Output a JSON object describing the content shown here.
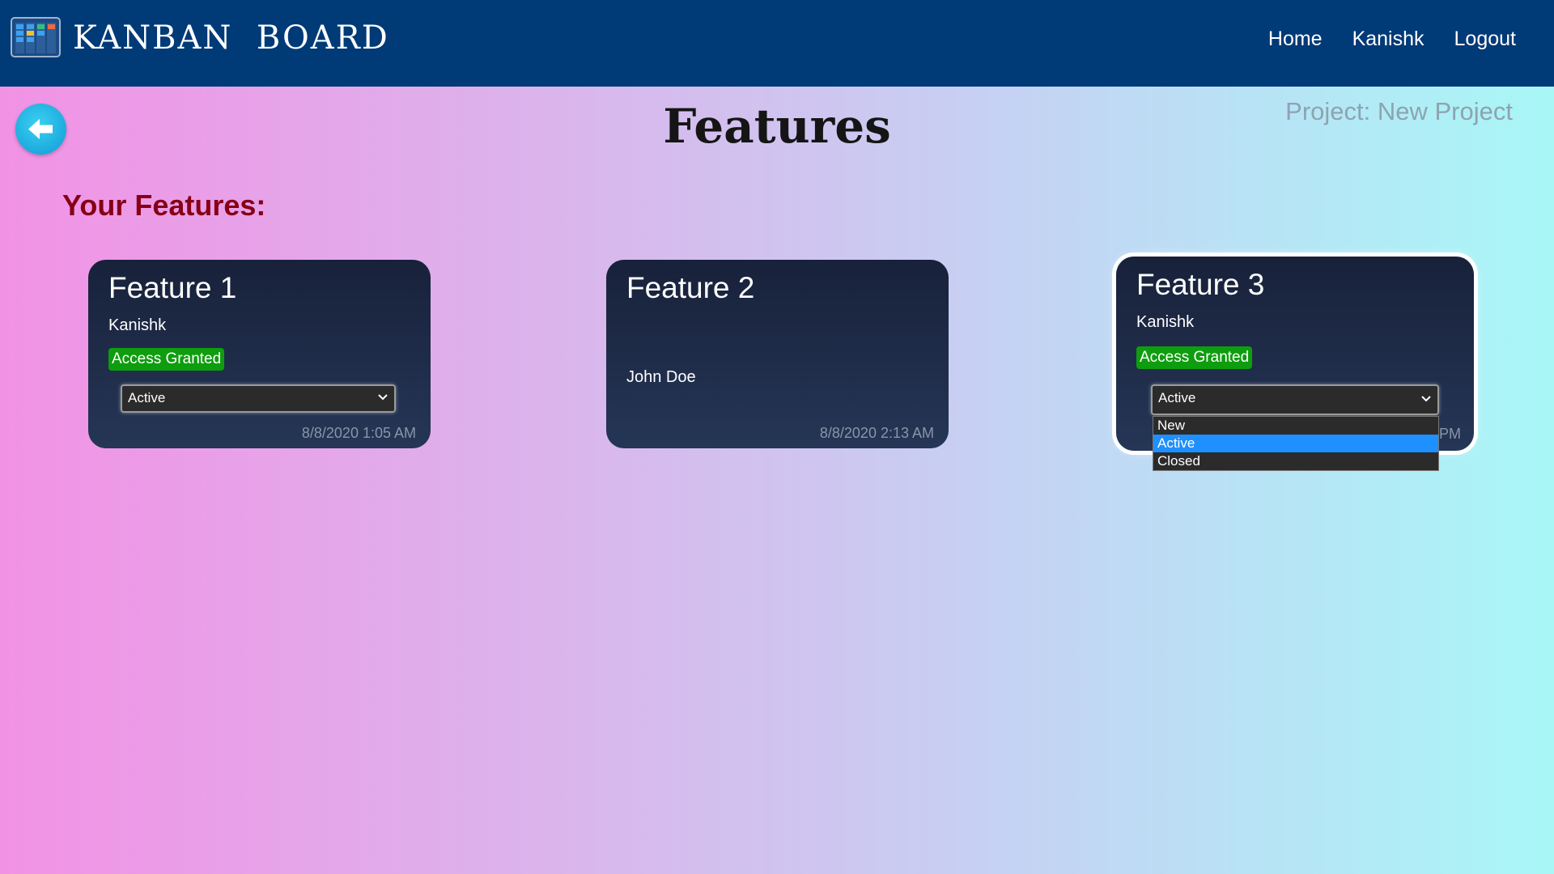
{
  "navbar": {
    "brand": "KANBAN  BOARD",
    "logo_icon": "kanban-board-icon",
    "links": [
      "Home",
      "Kanishk",
      "Logout"
    ]
  },
  "back_icon": "arrow-left-icon",
  "page": {
    "title": "Features",
    "project_label": "Project: New Project",
    "section_heading": "Your Features:"
  },
  "cards": [
    {
      "title": "Feature 1",
      "owner": "Kanishk",
      "badge": "Access Granted",
      "status": "Active",
      "date": "8/8/2020 1:05 AM"
    },
    {
      "title": "Feature 2",
      "owner": "John Doe",
      "date": "8/8/2020 2:13 AM"
    },
    {
      "title": "Feature 3",
      "owner": "Kanishk",
      "badge": "Access Granted",
      "status": "Active",
      "date_partial": "PM"
    }
  ],
  "dropdown": {
    "options": [
      "New",
      "Active",
      "Closed"
    ],
    "selected": "Active"
  },
  "colors": {
    "navbar": "#003a77",
    "heading": "#860016",
    "badge": "#0e9d0e",
    "selected_option": "#1e90ff"
  }
}
